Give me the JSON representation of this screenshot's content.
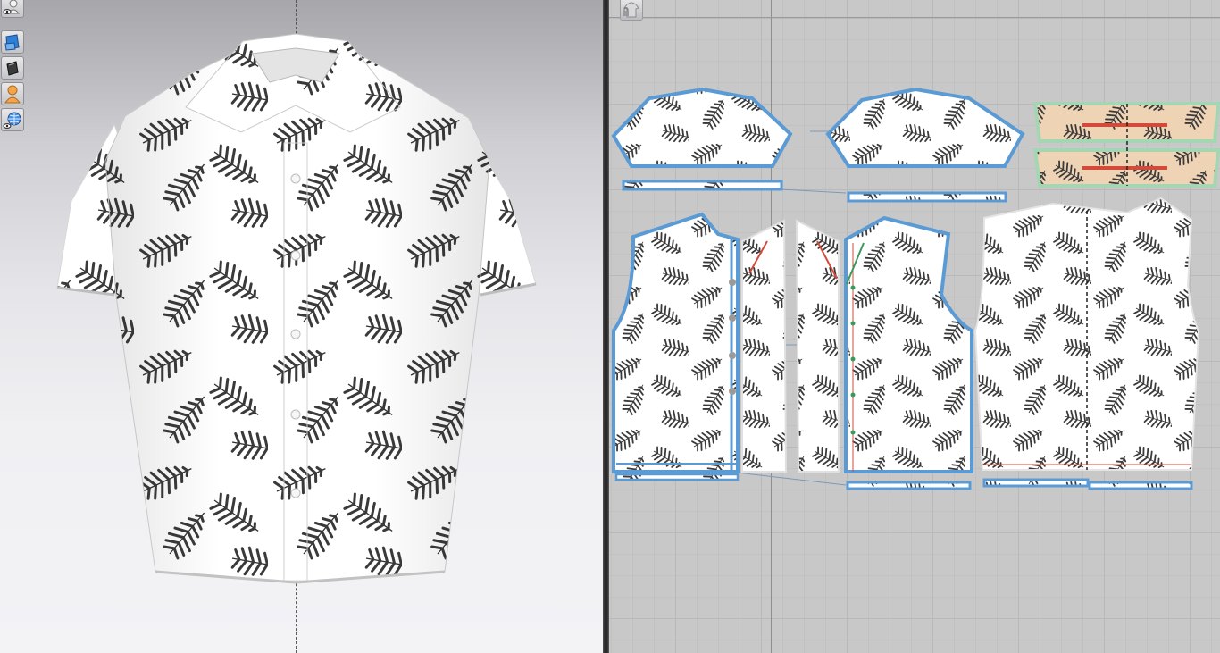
{
  "toolbar": {
    "tools": [
      {
        "name": "avatar-visibility-tool",
        "icon": "avatar-eye-icon"
      },
      {
        "name": "garment-display-tool",
        "icon": "blue-garment-icon"
      },
      {
        "name": "texture-display-tool",
        "icon": "dark-fabric-icon"
      },
      {
        "name": "avatar-tool",
        "icon": "orange-avatar-icon"
      },
      {
        "name": "environment-tool",
        "icon": "globe-eye-icon"
      }
    ]
  },
  "pattern_window": {
    "toggle_icon": "shirt-lock-icon"
  },
  "colors": {
    "viewport_bg_top": "#a7a7ab",
    "viewport_bg_bottom": "#f3f3f6",
    "pattern_grid_bg": "#c8c8c8",
    "fabric_white": "#ffffff",
    "leaf_print": "#3a3a3a",
    "selected_outline": "#5b9bd5",
    "yoke_fabric": "#efd3b5",
    "yoke_outline": "#a5d6b3",
    "seam_red": "#d24b3a",
    "seam_green": "#3a9a5a"
  },
  "print_name": "palm-leaf-print"
}
